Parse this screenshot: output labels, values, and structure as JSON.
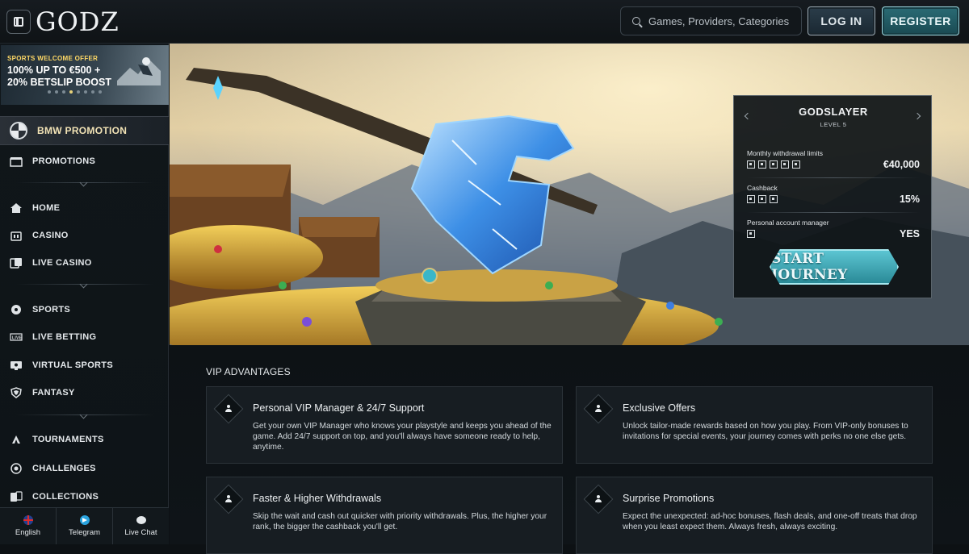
{
  "header": {
    "logo": "GODZ",
    "search_placeholder": "Games, Providers, Categories",
    "login_label": "LOG IN",
    "register_label": "REGISTER"
  },
  "sidebar": {
    "promo_banner": {
      "kicker": "SPORTS WELCOME OFFER",
      "headline": "100% UP TO €500 + 20% BETSLIP BOOST"
    },
    "bmw_label": "BMW PROMOTION",
    "items": [
      {
        "label": "PROMOTIONS",
        "icon": "gift-icon"
      },
      {
        "label": "HOME",
        "icon": "home-icon"
      },
      {
        "label": "CASINO",
        "icon": "casino-icon"
      },
      {
        "label": "LIVE CASINO",
        "icon": "live-casino-icon"
      },
      {
        "label": "SPORTS",
        "icon": "sports-ball-icon"
      },
      {
        "label": "LIVE BETTING",
        "icon": "live-betting-icon"
      },
      {
        "label": "VIRTUAL SPORTS",
        "icon": "virtual-sports-icon"
      },
      {
        "label": "FANTASY",
        "icon": "shield-icon"
      },
      {
        "label": "TOURNAMENTS",
        "icon": "tournament-icon"
      },
      {
        "label": "CHALLENGES",
        "icon": "target-icon"
      },
      {
        "label": "COLLECTIONS",
        "icon": "cards-icon"
      }
    ],
    "bottom": [
      {
        "label": "English",
        "icon": "uk-flag-icon"
      },
      {
        "label": "Telegram",
        "icon": "telegram-icon"
      },
      {
        "label": "Live Chat",
        "icon": "chat-icon"
      }
    ]
  },
  "vip_card": {
    "title": "GODSLAYER",
    "level": "LEVEL 5",
    "rows": [
      {
        "label": "Monthly withdrawal limits",
        "value": "€40,000",
        "rank_icons": 5
      },
      {
        "label": "Cashback",
        "value": "15%",
        "rank_icons": 3
      },
      {
        "label": "Personal account manager",
        "value": "YES",
        "rank_icons": 1
      }
    ],
    "cta_label": "START JOURNEY"
  },
  "advantages": {
    "title": "VIP ADVANTAGES",
    "cards": [
      {
        "title": "Personal VIP Manager & 24/7 Support",
        "desc": "Get your own VIP Manager who knows your playstyle and keeps you ahead of the game. Add 24/7 support on top, and you'll always have someone ready to help, anytime."
      },
      {
        "title": "Exclusive Offers",
        "desc": "Unlock tailor-made rewards based on how you play. From VIP-only bonuses to invitations for special events, your journey comes with perks no one else gets."
      },
      {
        "title": "Faster & Higher Withdrawals",
        "desc": "Skip the wait and cash out quicker with priority withdrawals. Plus, the higher your rank, the bigger the cashback you'll get."
      },
      {
        "title": "Surprise Promotions",
        "desc": "Expect the unexpected: ad-hoc bonuses, flash deals, and one-off treats that drop when you least expect them. Always fresh, always exciting."
      }
    ]
  }
}
